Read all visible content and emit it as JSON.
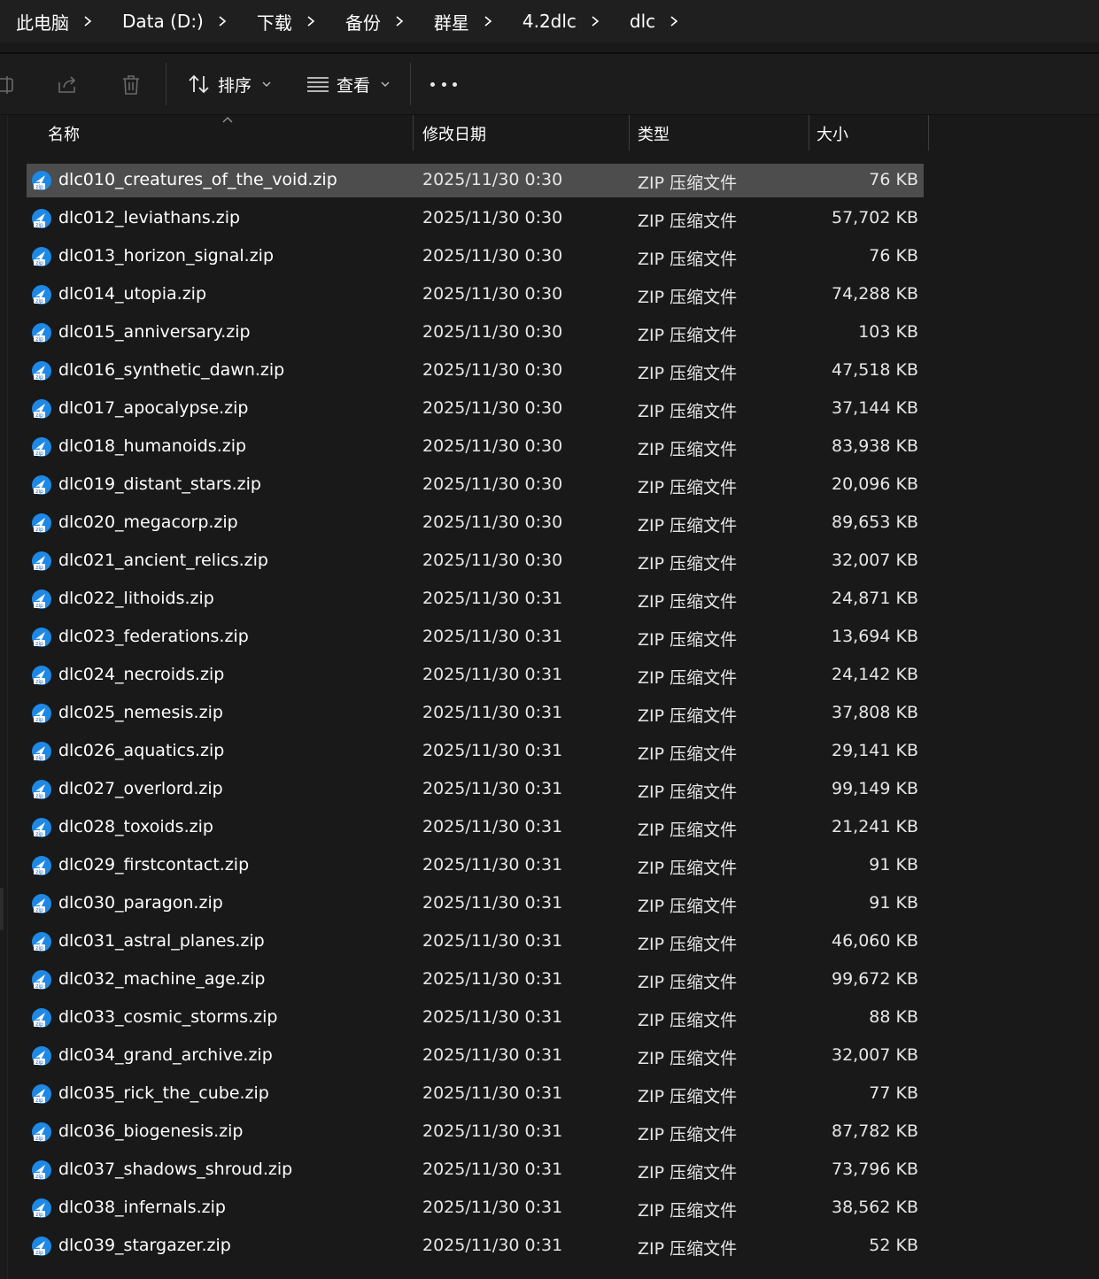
{
  "breadcrumb": [
    "此电脑",
    "Data (D:)",
    "下载",
    "备份",
    "群星",
    "4.2dlc",
    "dlc"
  ],
  "toolbar": {
    "sort_label": "排序",
    "view_label": "查看"
  },
  "columns": {
    "name": "名称",
    "date": "修改日期",
    "type": "类型",
    "size": "大小"
  },
  "colors": {
    "background": "#191919",
    "selected_row": "#4d4d4d",
    "zip_icon": "#1e88e5"
  },
  "files": [
    {
      "name": "dlc010_creatures_of_the_void.zip",
      "date": "2025/11/30 0:30",
      "type": "ZIP 压缩文件",
      "size": "76 KB",
      "selected": true
    },
    {
      "name": "dlc012_leviathans.zip",
      "date": "2025/11/30 0:30",
      "type": "ZIP 压缩文件",
      "size": "57,702 KB"
    },
    {
      "name": "dlc013_horizon_signal.zip",
      "date": "2025/11/30 0:30",
      "type": "ZIP 压缩文件",
      "size": "76 KB"
    },
    {
      "name": "dlc014_utopia.zip",
      "date": "2025/11/30 0:30",
      "type": "ZIP 压缩文件",
      "size": "74,288 KB"
    },
    {
      "name": "dlc015_anniversary.zip",
      "date": "2025/11/30 0:30",
      "type": "ZIP 压缩文件",
      "size": "103 KB"
    },
    {
      "name": "dlc016_synthetic_dawn.zip",
      "date": "2025/11/30 0:30",
      "type": "ZIP 压缩文件",
      "size": "47,518 KB"
    },
    {
      "name": "dlc017_apocalypse.zip",
      "date": "2025/11/30 0:30",
      "type": "ZIP 压缩文件",
      "size": "37,144 KB"
    },
    {
      "name": "dlc018_humanoids.zip",
      "date": "2025/11/30 0:30",
      "type": "ZIP 压缩文件",
      "size": "83,938 KB"
    },
    {
      "name": "dlc019_distant_stars.zip",
      "date": "2025/11/30 0:30",
      "type": "ZIP 压缩文件",
      "size": "20,096 KB"
    },
    {
      "name": "dlc020_megacorp.zip",
      "date": "2025/11/30 0:30",
      "type": "ZIP 压缩文件",
      "size": "89,653 KB"
    },
    {
      "name": "dlc021_ancient_relics.zip",
      "date": "2025/11/30 0:30",
      "type": "ZIP 压缩文件",
      "size": "32,007 KB"
    },
    {
      "name": "dlc022_lithoids.zip",
      "date": "2025/11/30 0:31",
      "type": "ZIP 压缩文件",
      "size": "24,871 KB"
    },
    {
      "name": "dlc023_federations.zip",
      "date": "2025/11/30 0:31",
      "type": "ZIP 压缩文件",
      "size": "13,694 KB"
    },
    {
      "name": "dlc024_necroids.zip",
      "date": "2025/11/30 0:31",
      "type": "ZIP 压缩文件",
      "size": "24,142 KB"
    },
    {
      "name": "dlc025_nemesis.zip",
      "date": "2025/11/30 0:31",
      "type": "ZIP 压缩文件",
      "size": "37,808 KB"
    },
    {
      "name": "dlc026_aquatics.zip",
      "date": "2025/11/30 0:31",
      "type": "ZIP 压缩文件",
      "size": "29,141 KB"
    },
    {
      "name": "dlc027_overlord.zip",
      "date": "2025/11/30 0:31",
      "type": "ZIP 压缩文件",
      "size": "99,149 KB"
    },
    {
      "name": "dlc028_toxoids.zip",
      "date": "2025/11/30 0:31",
      "type": "ZIP 压缩文件",
      "size": "21,241 KB"
    },
    {
      "name": "dlc029_firstcontact.zip",
      "date": "2025/11/30 0:31",
      "type": "ZIP 压缩文件",
      "size": "91 KB"
    },
    {
      "name": "dlc030_paragon.zip",
      "date": "2025/11/30 0:31",
      "type": "ZIP 压缩文件",
      "size": "91 KB"
    },
    {
      "name": "dlc031_astral_planes.zip",
      "date": "2025/11/30 0:31",
      "type": "ZIP 压缩文件",
      "size": "46,060 KB"
    },
    {
      "name": "dlc032_machine_age.zip",
      "date": "2025/11/30 0:31",
      "type": "ZIP 压缩文件",
      "size": "99,672 KB"
    },
    {
      "name": "dlc033_cosmic_storms.zip",
      "date": "2025/11/30 0:31",
      "type": "ZIP 压缩文件",
      "size": "88 KB"
    },
    {
      "name": "dlc034_grand_archive.zip",
      "date": "2025/11/30 0:31",
      "type": "ZIP 压缩文件",
      "size": "32,007 KB"
    },
    {
      "name": "dlc035_rick_the_cube.zip",
      "date": "2025/11/30 0:31",
      "type": "ZIP 压缩文件",
      "size": "77 KB"
    },
    {
      "name": "dlc036_biogenesis.zip",
      "date": "2025/11/30 0:31",
      "type": "ZIP 压缩文件",
      "size": "87,782 KB"
    },
    {
      "name": "dlc037_shadows_shroud.zip",
      "date": "2025/11/30 0:31",
      "type": "ZIP 压缩文件",
      "size": "73,796 KB"
    },
    {
      "name": "dlc038_infernals.zip",
      "date": "2025/11/30 0:31",
      "type": "ZIP 压缩文件",
      "size": "38,562 KB"
    },
    {
      "name": "dlc039_stargazer.zip",
      "date": "2025/11/30 0:31",
      "type": "ZIP 压缩文件",
      "size": "52 KB"
    }
  ]
}
